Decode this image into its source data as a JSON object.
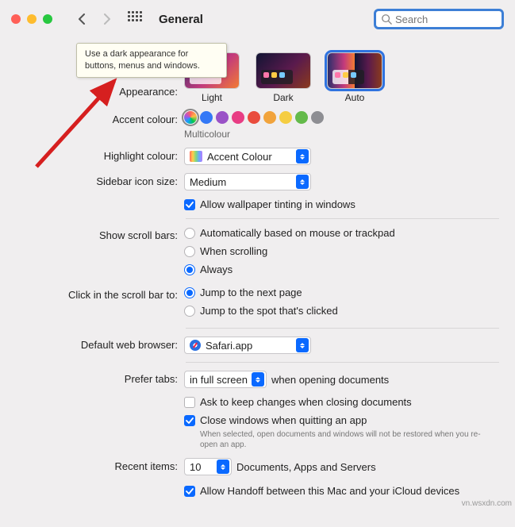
{
  "toolbar": {
    "title": "General"
  },
  "search": {
    "placeholder": "Search"
  },
  "tooltip": "Use a dark appearance for buttons, menus and windows.",
  "labels": {
    "appearance": "Appearance:",
    "accent": "Accent colour:",
    "highlight": "Highlight colour:",
    "sidebar_size": "Sidebar icon size:",
    "scroll_bars": "Show scroll bars:",
    "scroll_click": "Click in the scroll bar to:",
    "browser": "Default web browser:",
    "tabs": "Prefer tabs:",
    "recent": "Recent items:"
  },
  "appearance": {
    "options": [
      {
        "label": "Light"
      },
      {
        "label": "Dark"
      },
      {
        "label": "Auto"
      }
    ],
    "selected": 2
  },
  "accent": {
    "colors": [
      "conic-gradient(#ff605c,#ffbd44,#00ca4e,#14a0ff,#af52de,#ff605c)",
      "#3478f6",
      "#9a52c7",
      "#e83d84",
      "#e94c3d",
      "#f1a33c",
      "#f5cd41",
      "#64ba4a",
      "#8e8e93"
    ],
    "selected": 0,
    "name": "Multicolour"
  },
  "highlight": {
    "value": "Accent Colour"
  },
  "sidebar_size": {
    "value": "Medium"
  },
  "wallpaper_tint": {
    "checked": true,
    "label": "Allow wallpaper tinting in windows"
  },
  "scroll_bars": {
    "options": [
      "Automatically based on mouse or trackpad",
      "When scrolling",
      "Always"
    ],
    "selected": 2
  },
  "scroll_click": {
    "options": [
      "Jump to the next page",
      "Jump to the spot that's clicked"
    ],
    "selected": 0
  },
  "browser": {
    "value": "Safari.app"
  },
  "tabs": {
    "value": "in full screen",
    "suffix": "when opening documents",
    "ask_changes": {
      "checked": false,
      "label": "Ask to keep changes when closing documents"
    },
    "close_windows": {
      "checked": true,
      "label": "Close windows when quitting an app",
      "note": "When selected, open documents and windows will not be restored when you re-open an app."
    }
  },
  "recent": {
    "value": "10",
    "suffix": "Documents, Apps and Servers"
  },
  "handoff": {
    "checked": true,
    "label": "Allow Handoff between this Mac and your iCloud devices"
  },
  "watermark": "vn.wsxdn.com"
}
